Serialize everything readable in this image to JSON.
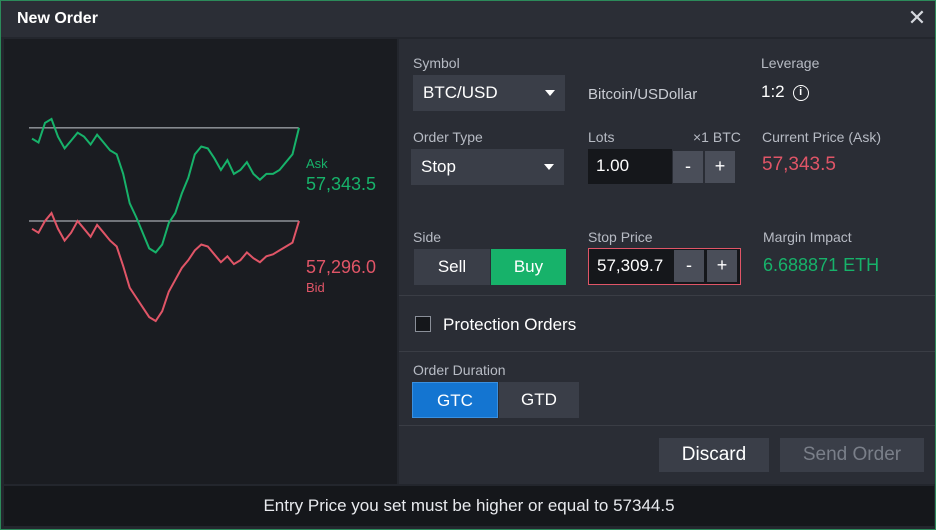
{
  "dialog": {
    "title": "New Order",
    "close_symbol": "✕"
  },
  "chart": {
    "ask_label": "Ask",
    "ask_price": "57,343.5",
    "bid_label": "Bid",
    "bid_price": "57,296.0",
    "colors": {
      "ask": "#17b26a",
      "bid": "#e05567",
      "line": "#c8ccd2"
    },
    "ask_series": [
      57338,
      57336,
      57346,
      57348,
      57339,
      57333,
      57337,
      57341,
      57339,
      57335,
      57340,
      57336,
      57332,
      57330,
      57320,
      57305,
      57298,
      57290,
      57282,
      57280,
      57284,
      57295,
      57300,
      57310,
      57318,
      57330,
      57334,
      57333,
      57328,
      57322,
      57327,
      57320,
      57322,
      57326,
      57320,
      57317,
      57320,
      57320,
      57322,
      57326,
      57330,
      57343.5
    ],
    "bid_series": [
      57292,
      57290,
      57296,
      57300,
      57292,
      57286,
      57290,
      57296,
      57292,
      57288,
      57294,
      57290,
      57286,
      57283,
      57273,
      57262,
      57257,
      57252,
      57247,
      57245,
      57250,
      57260,
      57266,
      57272,
      57276,
      57281,
      57284,
      57283,
      57279,
      57275,
      57278,
      57274,
      57276,
      57280,
      57277,
      57275,
      57278,
      57279,
      57281,
      57283,
      57285,
      57296.0
    ]
  },
  "form": {
    "symbol_label": "Symbol",
    "symbol_value": "BTC/USD",
    "symbol_name": "Bitcoin/USDollar",
    "leverage_label": "Leverage",
    "leverage_value": "1:2",
    "info_symbol": "i",
    "order_type_label": "Order Type",
    "order_type_value": "Stop",
    "lots_label": "Lots",
    "lots_unit": "×1 BTC",
    "lots_value": "1.00",
    "minus": "-",
    "plus": "+",
    "current_price_label": "Current Price (Ask)",
    "current_price_value": "57,343.5",
    "side_label": "Side",
    "sell_label": "Sell",
    "buy_label": "Buy",
    "stop_price_label": "Stop Price",
    "stop_price_value": "57,309.7",
    "margin_label": "Margin Impact",
    "margin_value": "6.688871 ETH",
    "protection_label": "Protection Orders",
    "duration_label": "Order Duration",
    "gtc_label": "GTC",
    "gtd_label": "GTD",
    "discard_label": "Discard",
    "send_label": "Send Order"
  },
  "footer": {
    "message": "Entry Price you set must be higher or equal to 57344.5"
  },
  "colors": {
    "green": "#17b26a",
    "red": "#e05567",
    "blue": "#1475d1"
  }
}
